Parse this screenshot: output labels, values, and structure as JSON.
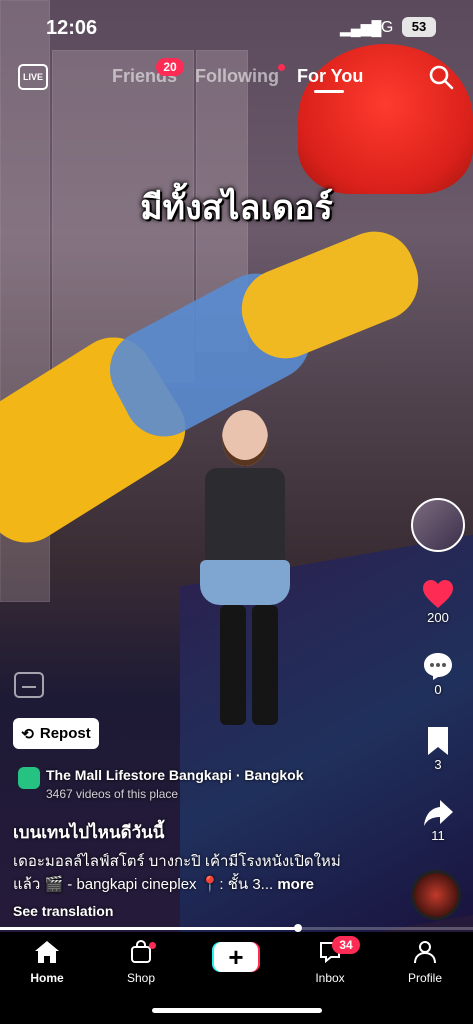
{
  "status_bar": {
    "time": "12:06",
    "network": "4G",
    "battery": "53"
  },
  "top_nav": {
    "live_label": "LIVE",
    "tabs": [
      {
        "label": "Friends",
        "badge": "20"
      },
      {
        "label": "Following"
      },
      {
        "label": "For You",
        "active": true
      }
    ]
  },
  "video": {
    "overlay_text": "มีทั้งสไลเดอร์"
  },
  "actions": {
    "likes": "200",
    "comments": "0",
    "saves": "3",
    "shares": "11"
  },
  "repost_label": "Repost",
  "place": {
    "title": "The Mall Lifestore Bangkapi · Bangkok",
    "subtitle": "3467 videos of this place"
  },
  "post": {
    "username": "เบนเทนไปไหนดีวันนี้",
    "caption_line1": "เดอะมอลล์ไลฟ์สโตร์ บางกะปิ เค้ามีโรงหนังเปิดใหม่",
    "caption_line2": "แล้ว 🎬 - bangkapi cineplex 📍: ชั้น 3...",
    "more_label": "more",
    "see_translation": "See translation"
  },
  "progress": 0.63,
  "bottom_nav": {
    "home": "Home",
    "shop": "Shop",
    "inbox": "Inbox",
    "inbox_badge": "34",
    "profile": "Profile"
  },
  "colors": {
    "accent": "#fe2c55",
    "cyan": "#25f4ee",
    "place_icon": "#25c281"
  }
}
